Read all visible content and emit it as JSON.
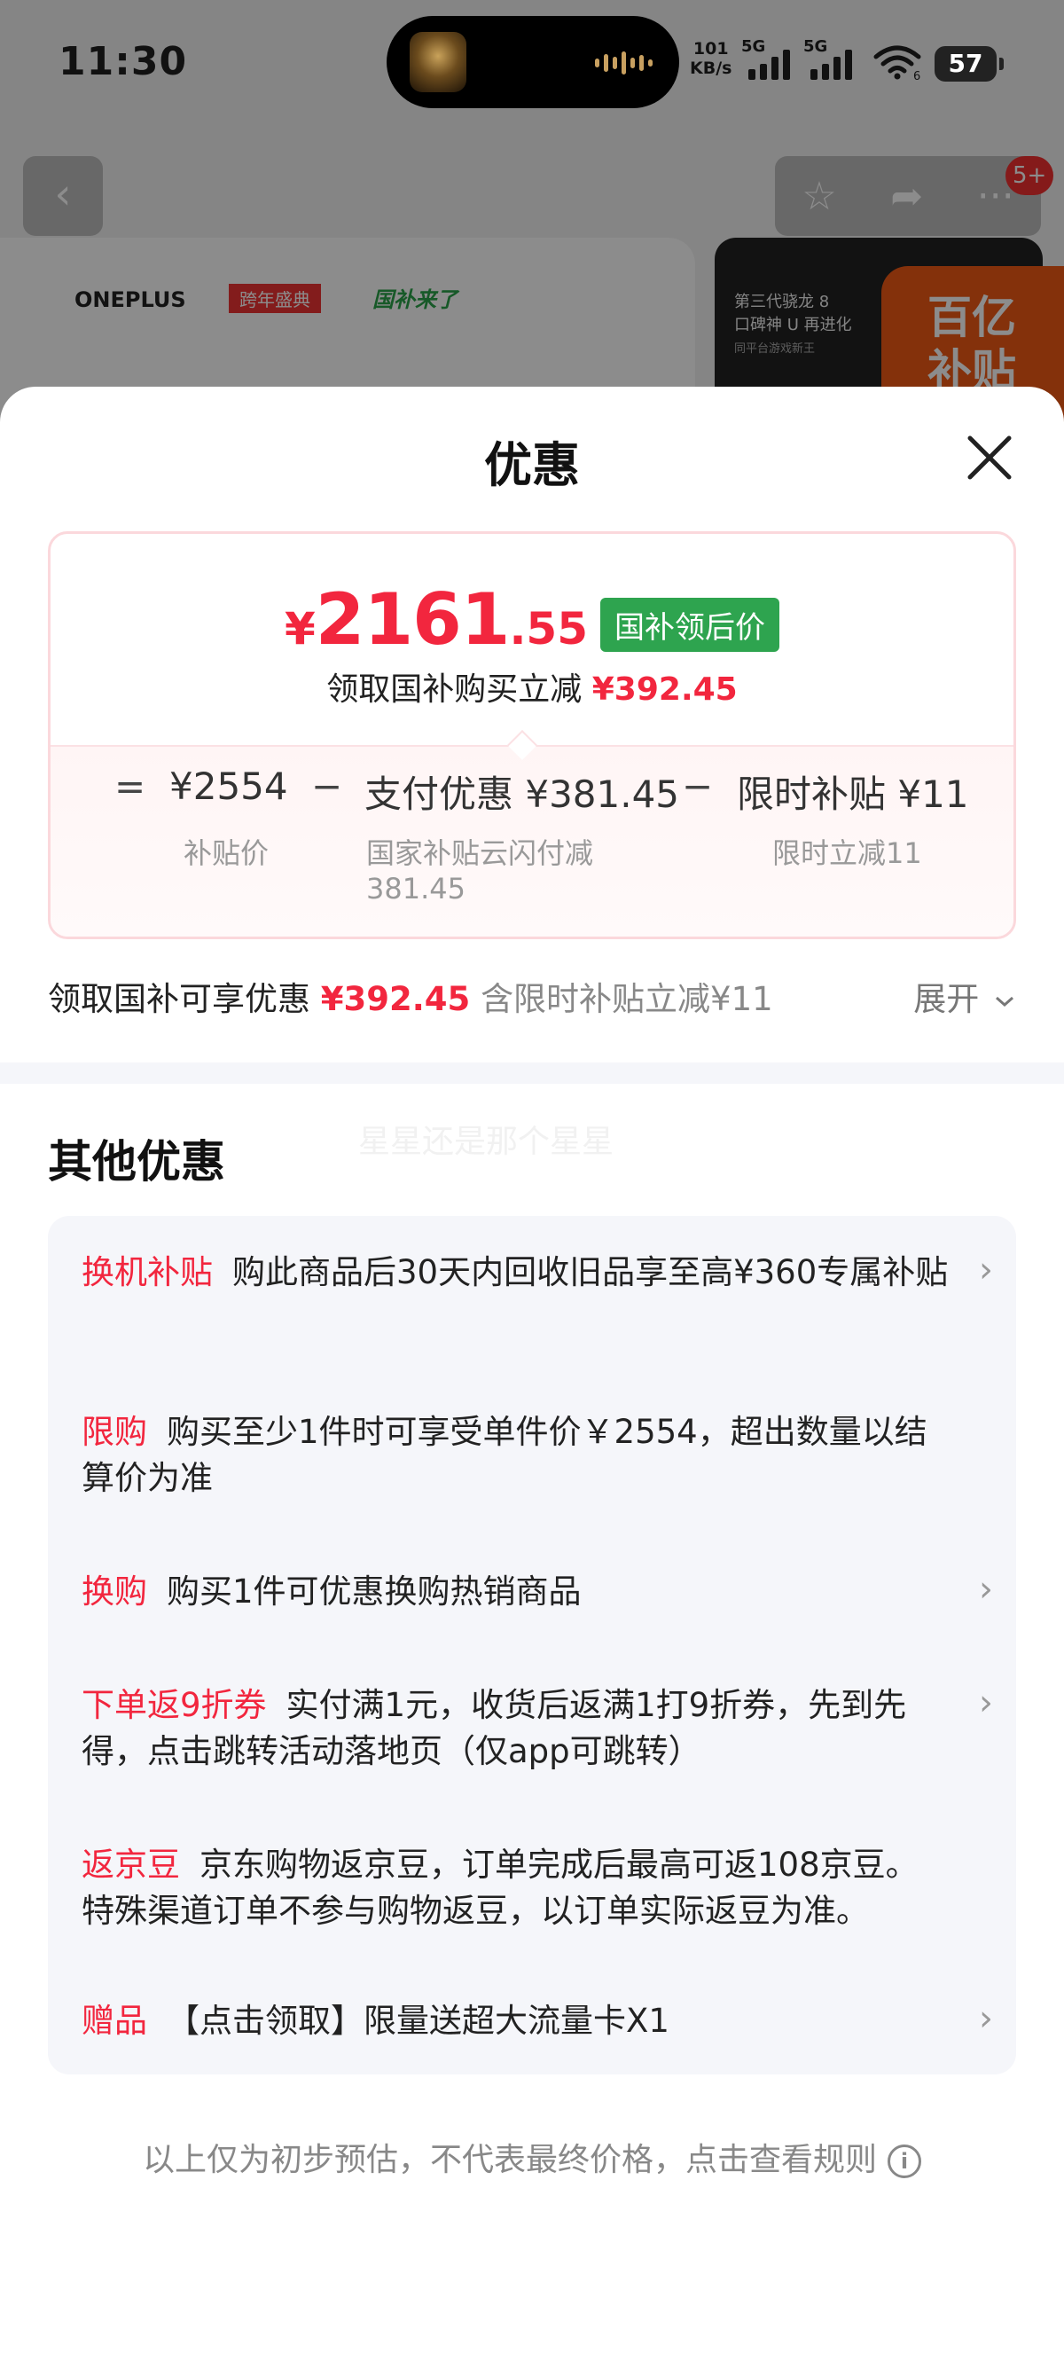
{
  "status_bar": {
    "time": "11:30",
    "net_speed_value": "101",
    "net_speed_unit": "KB/s",
    "signal1_label": "5G",
    "signal2_label": "5G",
    "wifi_level": "6",
    "battery": "57"
  },
  "background": {
    "back_icon": "chevron-left-icon",
    "message_badge": "5+",
    "brand_logo": "ONEPLUS",
    "brand_tag1": "跨年盛典",
    "brand_tag2": "国补来了",
    "promo_line1": "第三代骁龙 8",
    "promo_line2": "口碑神 U 再进化",
    "promo_sub": "同平台游戏新王",
    "subsidy_badge_line1": "百亿",
    "subsidy_badge_line2": "补贴"
  },
  "sheet": {
    "title": "优惠",
    "price": {
      "yen": "¥",
      "integer": "2161",
      "decimal": ".55",
      "tag": "国补领后价",
      "sub_text": "领取国补购买立减",
      "sub_amount": "¥392.45"
    },
    "formula": {
      "eq": "=",
      "base": "¥2554",
      "minus1": "−",
      "pay_discount": "支付优惠 ¥381.45",
      "minus2": "−",
      "limited": "限时补贴 ¥11",
      "cap_base": "补贴价",
      "cap_pay_line1": "国家补贴云闪付减",
      "cap_pay_line2": "381.45",
      "cap_limited": "限时立减11"
    },
    "gov_row": {
      "label": "领取国补可享优惠",
      "amount": "¥392.45",
      "note": "含限时补贴立减¥11",
      "expand": "展开"
    },
    "other_title": "其他优惠",
    "watermark": "星星还是那个星星",
    "offers": [
      {
        "tag": "换机补贴",
        "text": "购此商品后30天内回收旧品享至高¥360专属补贴",
        "has_chevron": true
      },
      {
        "tag": "限购",
        "text": "购买至少1件时可享受单件价￥2554，超出数量以结算价为准",
        "has_chevron": false
      },
      {
        "tag": "换购",
        "text": "购买1件可优惠换购热销商品",
        "has_chevron": true
      },
      {
        "tag": "下单返9折券",
        "text": "实付满1元，收货后返满1打9折券，先到先得，点击跳转活动落地页（仅app可跳转）",
        "has_chevron": true
      },
      {
        "tag": "返京豆",
        "text": "京东购物返京豆，订单完成后最高可返108京豆。特殊渠道订单不参与购物返豆，以订单实际返豆为准。",
        "has_chevron": false
      },
      {
        "tag": "赠品",
        "text": "【点击领取】限量送超大流量卡X1",
        "has_chevron": true
      }
    ],
    "footer_note": "以上仅为初步预估，不代表最终价格，点击查看规则"
  }
}
